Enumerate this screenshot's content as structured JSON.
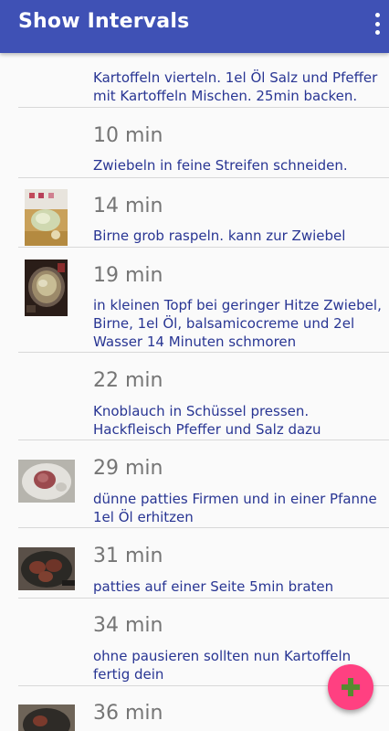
{
  "app_bar": {
    "title": "Show Intervals",
    "menu_icon": "more-vert-icon"
  },
  "intervals": [
    {
      "time": "",
      "text": "Kartoffeln vierteln. 1el Öl Salz und Pfeffer mit Kartoffeln Mischen. 25min backen.",
      "has_image": false
    },
    {
      "time": "10 min",
      "text": "Zwiebeln in feine Streifen schneiden.",
      "has_image": false
    },
    {
      "time": "14 min",
      "text": "Birne grob raspeln. kann zur Zwiebel",
      "has_image": true
    },
    {
      "time": "19 min",
      "text": "in kleinen Topf bei geringer Hitze Zwiebel, Birne, 1el Öl, balsamicocreme und 2el Wasser 14 Minuten schmoren",
      "has_image": true
    },
    {
      "time": "22 min",
      "text": "Knoblauch in Schüssel pressen. Hackfleisch Pfeffer und Salz dazu",
      "has_image": false
    },
    {
      "time": "29 min",
      "text": "dünne patties Firmen und in einer Pfanne 1el Öl erhitzen",
      "has_image": true
    },
    {
      "time": "31 min",
      "text": "patties auf einer Seite 5min braten",
      "has_image": true
    },
    {
      "time": "34 min",
      "text": "ohne pausieren sollten nun Kartoffeln fertig dein",
      "has_image": false
    },
    {
      "time": "36 min",
      "text": "",
      "has_image": true
    }
  ],
  "fab": {
    "icon": "add-icon"
  },
  "colors": {
    "primary": "#3f51b5",
    "accent": "#ff4081",
    "fab_icon": "#558b2f",
    "description_text": "#283593",
    "time_text": "#757575"
  }
}
